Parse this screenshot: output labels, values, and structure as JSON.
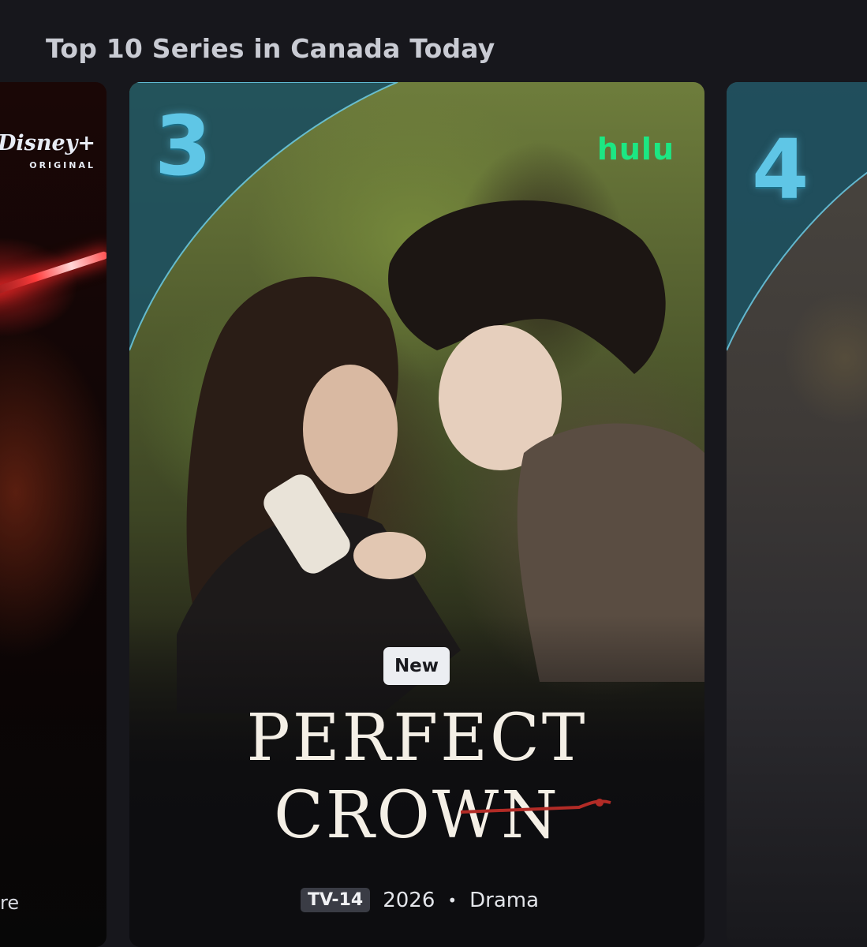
{
  "row": {
    "title": "Top 10 Series in Canada Today"
  },
  "left_card": {
    "brand_logo": "Disney+",
    "brand_sub": "ORIGINAL",
    "title_fragment": "re"
  },
  "main_card": {
    "rank": "3",
    "network": "hulu",
    "badge": "New",
    "title_line1": "PERFECT",
    "title_line2": "CROWN",
    "rating": "TV-14",
    "year": "2026",
    "separator": "•",
    "genre": "Drama"
  },
  "right_card": {
    "rank": "4"
  },
  "colors": {
    "background": "#17171c",
    "rank_accent": "#5fc6e6",
    "hulu_green": "#1ce783"
  }
}
